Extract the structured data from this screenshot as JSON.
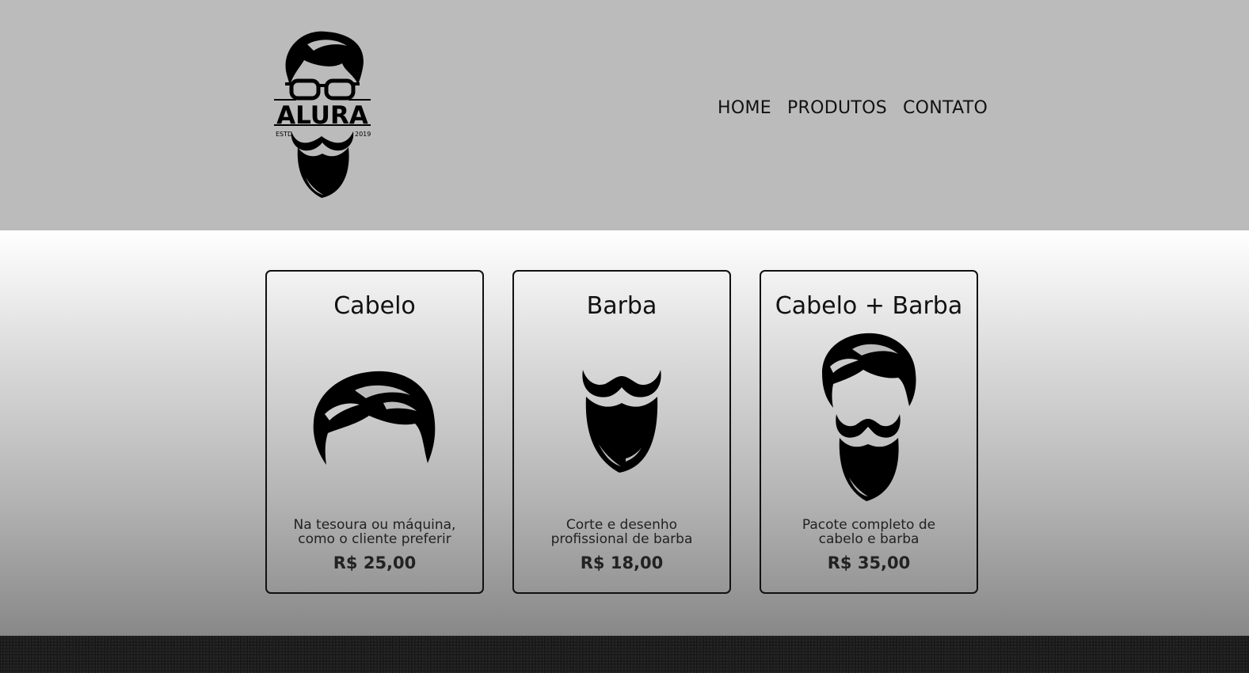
{
  "header": {
    "logo": {
      "brand": "ALURA",
      "estd_label": "ESTD",
      "year": "2019",
      "icon": "bearded-man-glasses-logo"
    },
    "nav": [
      {
        "label": "HOME"
      },
      {
        "label": "PRODUTOS"
      },
      {
        "label": "CONTATO"
      }
    ]
  },
  "products": [
    {
      "title": "Cabelo",
      "desc_line1": "Na tesoura ou máquina,",
      "desc_line2": "como o cliente preferir",
      "price": "R$ 25,00",
      "icon": "hair-icon"
    },
    {
      "title": "Barba",
      "desc_line1": "Corte e desenho",
      "desc_line2": "profissional de barba",
      "price": "R$ 18,00",
      "icon": "beard-icon"
    },
    {
      "title": "Cabelo + Barba",
      "desc_line1": "Pacote completo de",
      "desc_line2": "cabelo e barba",
      "price": "R$ 35,00",
      "icon": "hair-and-beard-icon"
    }
  ],
  "colors": {
    "header_bg": "#bbbbbb",
    "text": "#111111",
    "footer_bg": "#1e1e1e"
  }
}
